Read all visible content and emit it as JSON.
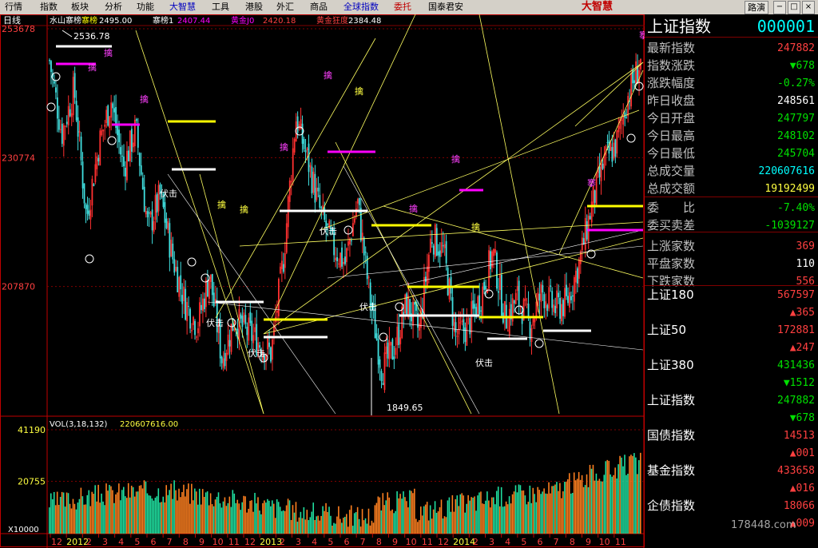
{
  "menu": [
    "行情",
    "指数",
    "板块",
    "分析",
    "功能",
    "大智慧",
    "工具",
    "港股",
    "外汇",
    "商品",
    "全球指数",
    "委托",
    "国泰君安"
  ],
  "brand": "大智慧",
  "restore_label": "路演",
  "period_label": "日线",
  "ma_legend": "水山寨榜 寨榜 2495.00 寨榜1 2407.44 黄金J0 2420.18 黄金狂度 2384.48",
  "price_axis": [
    "253678",
    "230774",
    "207870"
  ],
  "annotations": {
    "high": "2536.78",
    "low": "1849.65"
  },
  "vol_legend": "VOL(3,18,132)",
  "vol_value": "220607616.00",
  "vol_axis": [
    "41190",
    "20755",
    "X10000"
  ],
  "x_labels": [
    "12",
    "2012",
    "2",
    "3",
    "4",
    "5",
    "6",
    "7",
    "8",
    "9",
    "10",
    "11",
    "12",
    "2013",
    "2",
    "3",
    "4",
    "5",
    "6",
    "7",
    "8",
    "9",
    "10",
    "11",
    "12",
    "2014",
    "2",
    "3",
    "4",
    "5",
    "6",
    "7",
    "8",
    "9",
    "10",
    "11"
  ],
  "panel": {
    "name": "上证指数",
    "code": "000001",
    "rows": [
      {
        "label": "最新指数",
        "value": "247882",
        "color": "red"
      },
      {
        "label": "指数涨跌",
        "value": "▼678",
        "color": "grn"
      },
      {
        "label": "涨跌幅度",
        "value": "-0.27%",
        "color": "grn"
      },
      {
        "label": "昨日收盘",
        "value": "248561",
        "color": "wht"
      },
      {
        "label": "今日开盘",
        "value": "247797",
        "color": "grn"
      },
      {
        "label": "今日最高",
        "value": "248102",
        "color": "grn"
      },
      {
        "label": "今日最低",
        "value": "245704",
        "color": "grn"
      },
      {
        "label": "总成交量",
        "value": "220607616",
        "color": "cyn"
      },
      {
        "label": "总成交额",
        "value": "19192499",
        "color": "yel"
      },
      {
        "label": "委　　比",
        "value": "-7.40%",
        "color": "grn"
      },
      {
        "label": "委买卖差",
        "value": "-1039127",
        "color": "grn"
      },
      {
        "label": "上涨家数",
        "value": "369",
        "color": "red"
      },
      {
        "label": "平盘家数",
        "value": "110",
        "color": "wht"
      },
      {
        "label": "下跌家数",
        "value": "556",
        "color": "red"
      }
    ],
    "subs": [
      {
        "label": "上证180",
        "value": "567597",
        "change": "▲365",
        "vcolor": "red",
        "ccolor": "red"
      },
      {
        "label": "上证50",
        "value": "172881",
        "change": "▲247",
        "vcolor": "red",
        "ccolor": "red"
      },
      {
        "label": "上证380",
        "value": "431436",
        "change": "▼1512",
        "vcolor": "grn",
        "ccolor": "grn"
      },
      {
        "label": "上证指数",
        "value": "247882",
        "change": "▼678",
        "vcolor": "grn",
        "ccolor": "grn"
      },
      {
        "label": "国债指数",
        "value": "14513",
        "change": "▲001",
        "vcolor": "red",
        "ccolor": "red"
      },
      {
        "label": "基金指数",
        "value": "433658",
        "change": "▲016",
        "vcolor": "red",
        "ccolor": "red"
      },
      {
        "label": "企债指数",
        "value": "18066",
        "change": "▲009",
        "vcolor": "red",
        "ccolor": "red"
      }
    ]
  },
  "watermark": "178448.com",
  "chart_data": [
    {
      "type": "candlestick",
      "title": "上证指数 日线",
      "x_range": [
        "2011-12",
        "2014-11"
      ],
      "ylim": [
        1849.65,
        2536.78
      ],
      "y_ticks": [
        2536.78,
        2307.74,
        2078.7
      ],
      "key_points": [
        {
          "label": "high",
          "value": 2536.78
        },
        {
          "label": "low",
          "value": 1849.65
        }
      ],
      "close_series_approx": [
        2480,
        2350,
        2430,
        2200,
        2330,
        2410,
        2290,
        2360,
        2180,
        2240,
        2130,
        2050,
        2010,
        2100,
        1950,
        2020,
        2000,
        1980,
        1960,
        2130,
        2380,
        2300,
        2210,
        2150,
        2120,
        2230,
        2060,
        1930,
        1970,
        2050,
        2000,
        2170,
        2140,
        1990,
        2010,
        2060,
        2140,
        2020,
        2060,
        2010,
        2070,
        2040,
        2050,
        2120,
        2220,
        2300,
        2330,
        2420,
        2479
      ]
    },
    {
      "type": "bar",
      "title": "VOL(3,18,132)",
      "ylim": [
        0,
        41190
      ],
      "y_ticks": [
        41190,
        20755
      ],
      "latest": 220607616
    }
  ]
}
